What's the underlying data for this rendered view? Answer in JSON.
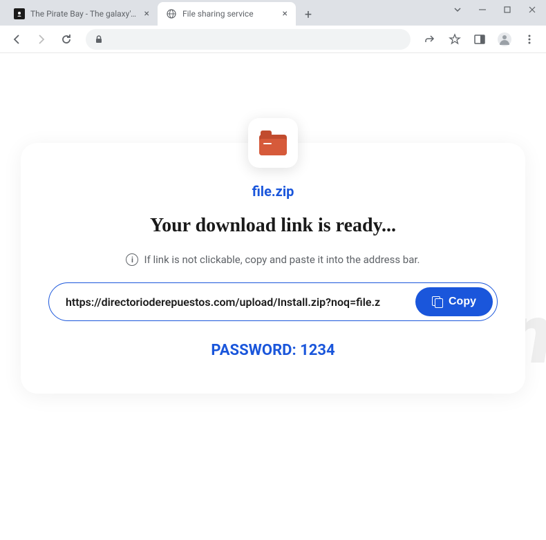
{
  "tabs": [
    {
      "title": "The Pirate Bay - The galaxy's mos",
      "active": false
    },
    {
      "title": "File sharing service",
      "active": true
    }
  ],
  "page": {
    "filename": "file.zip",
    "headline": "Your download link is ready...",
    "hint": "If link is not clickable, copy and paste it into the address bar.",
    "url": "https://directorioderepuestos.com/upload/Install.zip?noq=file.z",
    "copy_label": "Copy",
    "password_label": "PASSWORD: 1234"
  },
  "watermark": "risk.com"
}
